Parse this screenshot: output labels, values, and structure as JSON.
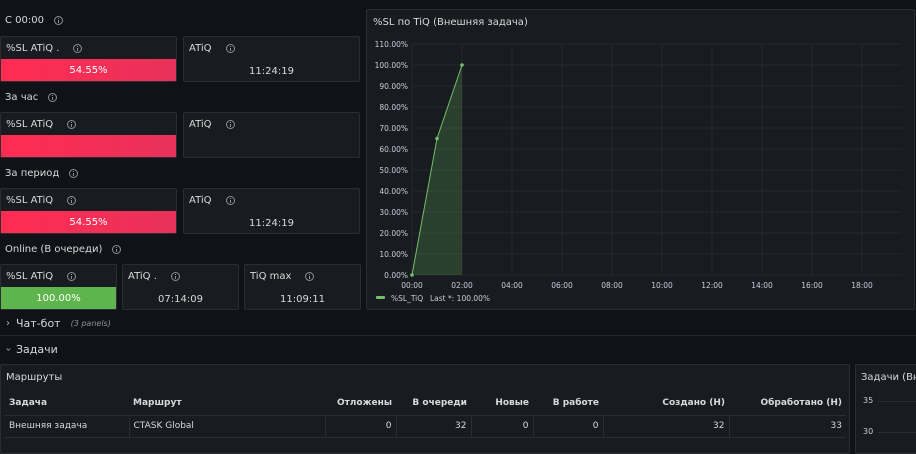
{
  "sections": {
    "since_midnight": "С 00:00",
    "per_hour": "За час",
    "per_period": "За период",
    "online": "Online (В очереди)"
  },
  "panels": {
    "s1": {
      "sl_title": "%SL ATiQ .",
      "sl_value": "54.55%",
      "atiq_title": "ATiQ",
      "atiq_value": "11:24:19"
    },
    "s2": {
      "sl_title": "%SL ATiQ",
      "sl_value": "",
      "atiq_title": "ATiQ",
      "atiq_value": ""
    },
    "s3": {
      "sl_title": "%SL ATiQ",
      "sl_value": "54.55%",
      "atiq_title": "ATiQ",
      "atiq_value": "11:24:19"
    },
    "s4": {
      "sl_title": "%SL ATiQ",
      "sl_value": "100.00%",
      "atiq_title": "ATiQ .",
      "atiq_value": "07:14:09",
      "max_title": "TiQ max",
      "max_value": "11:09:11"
    }
  },
  "colors": {
    "red": "#ff2c52",
    "green": "#5fb54d",
    "series": "#73bf69"
  },
  "chart_data": {
    "type": "area",
    "title": "%SL по TiQ (Внешняя задача)",
    "x": [
      "00:00",
      "01:00",
      "02:00",
      "03:00"
    ],
    "series": [
      {
        "name": "%SL_TiQ",
        "values": [
          0,
          65,
          100,
          null
        ]
      }
    ],
    "xticks": [
      "00:00",
      "02:00",
      "04:00",
      "06:00",
      "08:00",
      "10:00",
      "12:00",
      "14:00",
      "16:00",
      "18:00"
    ],
    "yticks": [
      "0.00%",
      "10.00%",
      "20.00%",
      "30.00%",
      "40.00%",
      "50.00%",
      "60.00%",
      "70.00%",
      "80.00%",
      "90.00%",
      "100.00%",
      "110.00%"
    ],
    "ylim": [
      0,
      110
    ],
    "xlim_hours": [
      0,
      19
    ],
    "legend": "%SL_TiQ",
    "legend_last": "Last *: 100.00%",
    "legend_placement": "bottom-left"
  },
  "rows": {
    "chatbot": {
      "label": "Чат-бот",
      "sub": "(3 panels)"
    },
    "tasks": {
      "label": "Задачи"
    }
  },
  "routes": {
    "title": "Маршруты",
    "headers": [
      "Задача",
      "Маршрут",
      "Отложены",
      "В очереди",
      "Новые",
      "В работе",
      "Создано (Н)",
      "Обработано (Н)"
    ],
    "row": [
      "Внешняя задача",
      "CTASK Global",
      "0",
      "32",
      "0",
      "0",
      "32",
      "33"
    ]
  },
  "tasks_panel": {
    "title": "Задачи (Вне",
    "y_labels": [
      "35",
      "30"
    ]
  }
}
